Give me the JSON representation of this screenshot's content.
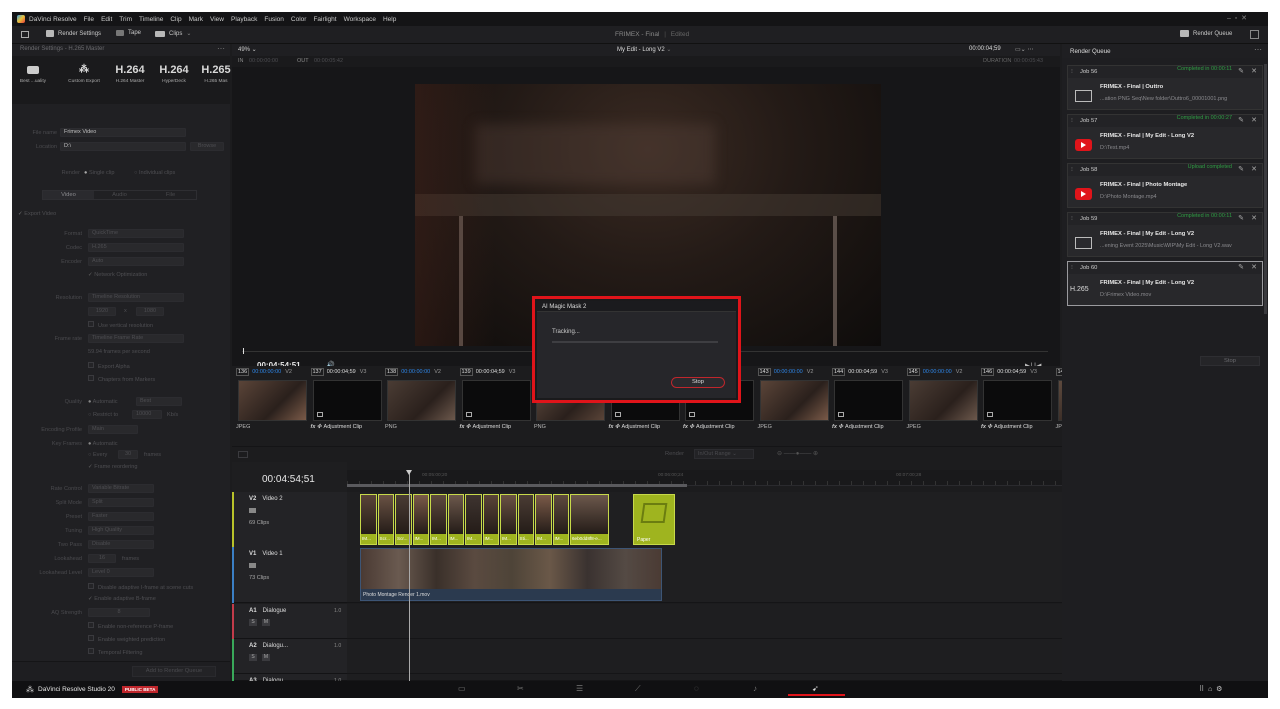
{
  "menubar": {
    "app": "DaVinci Resolve",
    "items": [
      "File",
      "Edit",
      "Trim",
      "Timeline",
      "Clip",
      "Mark",
      "View",
      "Playback",
      "Fusion",
      "Color",
      "Fairlight",
      "Workspace",
      "Help"
    ],
    "project": "FRIMEX - Final",
    "status": "Edited"
  },
  "toolbar": {
    "render_settings": "Render Settings",
    "tape": "Tape",
    "clips": "Clips",
    "render_queue": "Render Queue"
  },
  "left": {
    "header": "Render Settings - H.265 Master",
    "presets": [
      {
        "big": "",
        "label": "Best ...uality"
      },
      {
        "big": "",
        "label": "Custom Export"
      },
      {
        "big": "H.264",
        "label": "H.264 Master"
      },
      {
        "big": "H.264",
        "label": "HyperDeck"
      },
      {
        "big": "H.265",
        "label": "H.265 Mas"
      }
    ],
    "file_name_label": "File name",
    "file_name": "Frimex Video",
    "location_label": "Location",
    "location": "D:\\",
    "browse": "Browse",
    "render_label": "Render",
    "single_clip": "Single clip",
    "individual_clips": "Individual clips",
    "tabs": [
      "Video",
      "Audio",
      "File"
    ],
    "export_video": "Export Video",
    "format_label": "Format",
    "format": "QuickTime",
    "codec_label": "Codec",
    "codec": "H.265",
    "encoder_label": "Encoder",
    "encoder": "Auto",
    "network_opt": "Network Optimization",
    "resolution_label": "Resolution",
    "resolution": "Timeline Resolution",
    "res_w": "1920",
    "res_x": "x",
    "res_h": "1080",
    "vertical_res": "Use vertical resolution",
    "frame_rate_label": "Frame rate",
    "frame_rate": "Timeline Frame Rate",
    "fps_note": "59.94 frames per second",
    "export_alpha": "Export Alpha",
    "chapters": "Chapters from Markers",
    "quality_label": "Quality",
    "quality_auto": "Automatic",
    "quality_val": "Best",
    "restrict_to": "Restrict to",
    "restrict_val": "10000",
    "kbs": "Kb/s",
    "enc_profile_label": "Encoding Profile",
    "enc_profile": "Main",
    "keyframes_label": "Key Frames",
    "kf_auto": "Automatic",
    "kf_every": "Every",
    "kf_val": "30",
    "kf_frames": "frames",
    "frame_reorder": "Frame reordering",
    "rate_control_label": "Rate Control",
    "rate_control": "Variable Bitrate",
    "split_mode_label": "Split Mode",
    "split_mode": "Split",
    "preset_label": "Preset",
    "preset": "Faster",
    "tuning_label": "Tuning",
    "tuning": "High Quality",
    "two_pass_label": "Two Pass",
    "two_pass": "Disable",
    "lookahead_label": "Lookahead",
    "lookahead_val": "16",
    "lookahead_unit": "frames",
    "lookahead_level_label": "Lookahead Level",
    "lookahead_level": "Level 0",
    "disable_iframe": "Disable adaptive I-frame at scene cuts",
    "enable_bframe": "Enable adaptive B-frame",
    "aq_label": "AQ Strength",
    "aq_val": "8",
    "nonref": "Enable non-reference P-frame",
    "weighted": "Enable weighted prediction",
    "temporal": "Temporal Filtering",
    "add_queue": "Add to Render Queue"
  },
  "viewer": {
    "zoom": "49%",
    "timeline_name": "My Edit - Long V2",
    "tc_top": "00:00:04;59",
    "in_label": "IN",
    "in_tc": "00:00:00:00",
    "out_label": "OUT",
    "out_tc": "00:00:05:42",
    "duration_label": "DURATION",
    "duration_tc": "00:00:05:43",
    "timecode": "00:04:54;51"
  },
  "strip": {
    "clips": [
      {
        "num": "136",
        "tc": "00:00:00:00",
        "track": "V2",
        "label": "JPEG",
        "kind": "photo"
      },
      {
        "num": "137",
        "tc": "00:00:04;59",
        "track": "V3",
        "label": "Adjustment Clip",
        "kind": "adj"
      },
      {
        "num": "138",
        "tc": "00:00:00:00",
        "track": "V2",
        "label": "PNG",
        "kind": "photo"
      },
      {
        "num": "139",
        "tc": "00:00:04;59",
        "track": "V3",
        "label": "Adjustment Clip",
        "kind": "adj"
      },
      {
        "num": "",
        "tc": "",
        "track": "",
        "label": "PNG",
        "kind": "photo"
      },
      {
        "num": "",
        "tc": "",
        "track": "",
        "label": "Adjustment Clip",
        "kind": "adj"
      },
      {
        "num": "",
        "tc": "",
        "track": "",
        "label": "Adjustment Clip",
        "kind": "adj"
      },
      {
        "num": "143",
        "tc": "00:00:00:00",
        "track": "V2",
        "label": "JPEG",
        "kind": "photo"
      },
      {
        "num": "144",
        "tc": "00:00:04;59",
        "track": "V3",
        "label": "Adjustment Clip",
        "kind": "adj"
      },
      {
        "num": "145",
        "tc": "00:00:00:00",
        "track": "V2",
        "label": "JPEG",
        "kind": "photo"
      },
      {
        "num": "146",
        "tc": "00:00:04;59",
        "track": "V3",
        "label": "Adjustment Clip",
        "kind": "adj"
      },
      {
        "num": "147",
        "tc": "00:00:00:00",
        "track": "V2",
        "label": "JPEG",
        "kind": "photo"
      },
      {
        "num": "148",
        "tc": "00:00:04;59",
        "track": "V3",
        "label": "Adjustment Clip",
        "kind": "adj"
      },
      {
        "num": "149",
        "tc": "00:00:00:00",
        "track": "",
        "label": "JPEG",
        "kind": "photo"
      }
    ]
  },
  "timeline": {
    "render_label": "Render",
    "render_range": "In/Out Range",
    "tc": "00:04:54;51",
    "ruler": [
      "00:05:00;20",
      "00:06:00;24",
      "00:07:00;28",
      "00:08:00;32"
    ],
    "tracks": [
      {
        "id": "V2",
        "name": "Video 2",
        "clips": "69 Clips",
        "color": "#b8c22a"
      },
      {
        "id": "V1",
        "name": "Video 1",
        "clips": "73 Clips",
        "color": "#3b7fc4"
      },
      {
        "id": "A1",
        "name": "Dialogue",
        "level": "1.0",
        "color": "#c23b4a"
      },
      {
        "id": "A2",
        "name": "Dialogu...",
        "level": "1.0",
        "color": "#39a85a"
      },
      {
        "id": "A3",
        "name": "Dialogu...",
        "level": "1.0",
        "color": "#39a85a"
      }
    ],
    "v2_clip_labels": [
      "IM...",
      "Scr...",
      "Scr...",
      "IM...",
      "IM...",
      "IM...",
      "IM...",
      "IM...",
      "IM...",
      "Sti...",
      "IM...",
      "IM...",
      "6eb0dd8f8-e..."
    ],
    "paper_label": "Paper",
    "v1_clip": "Photo Montage Render 1.mov",
    "solo": "S",
    "mute": "M"
  },
  "render_queue": {
    "title": "Render Queue",
    "jobs": [
      {
        "id": "Job 56",
        "status": "Completed in 00:00:11",
        "title": "FRIMEX - Final | Outtro",
        "path": "...ation PNG Seq\\New folder\\Outtro6_00001001.png",
        "thumb": "monitor"
      },
      {
        "id": "Job 57",
        "status": "Completed in 00:00:27",
        "title": "FRIMEX - Final | My Edit - Long V2",
        "path": "D:\\Test.mp4",
        "thumb": "youtube"
      },
      {
        "id": "Job 58",
        "status": "Upload completed",
        "title": "FRIMEX - Final | Photo Montage",
        "path": "D:\\Photo Montage.mp4",
        "thumb": "youtube"
      },
      {
        "id": "Job 59",
        "status": "Completed in 00:00:11",
        "title": "FRIMEX - Final | My Edit - Long V2",
        "path": "...ening Event 2025\\Music\\WIP\\My Edit - Long V2.wav",
        "thumb": "monitor"
      },
      {
        "id": "Job 60",
        "status": "",
        "title": "FRIMEX - Final | My Edit - Long V2",
        "path": "D:\\Frimex Video.mov",
        "thumb": "H.265"
      }
    ],
    "stop": "Stop"
  },
  "dialog": {
    "title": "AI Magic Mask 2",
    "status": "Tracking...",
    "stop": "Stop"
  },
  "bottom": {
    "brand": "DaVinci Resolve Studio 20",
    "badge": "PUBLIC BETA",
    "pages": [
      "media-icon",
      "cut-icon",
      "edit-icon",
      "fusion-icon",
      "color-icon",
      "fairlight-icon",
      "deliver-icon"
    ]
  },
  "colors": {
    "accent": "#e0141a",
    "completed": "#2f9e44",
    "v2_clip": "#9fb41f",
    "tc_blue": "#2e86e8"
  }
}
